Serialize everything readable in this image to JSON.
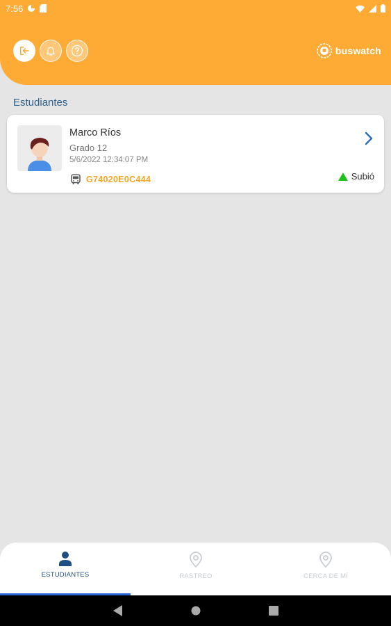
{
  "status_bar": {
    "time": "7:56"
  },
  "header": {
    "logo_text": "buswatch",
    "accent_color": "#fdab34"
  },
  "section": {
    "title": "Estudiantes"
  },
  "student": {
    "name": "Marco Ríos",
    "grade": "Grado 12",
    "timestamp": "5/6/2022 12:34:07 PM",
    "bus_id": "G74020E0C444",
    "status": "Subió",
    "status_color": "#22c01e"
  },
  "bottom_nav": {
    "tabs": [
      {
        "label": "ESTUDIANTES",
        "icon": "person-icon",
        "active": true
      },
      {
        "label": "RASTREO",
        "icon": "location-pin-icon",
        "active": false
      },
      {
        "label": "CERCA DE MÍ",
        "icon": "location-pin-icon",
        "active": false
      }
    ]
  },
  "icons": {
    "logout": "logout-icon",
    "notifications": "bell-icon",
    "help": "help-icon",
    "chevron": "chevron-right-icon",
    "bus": "bus-icon",
    "status": "triangle-up-icon"
  }
}
